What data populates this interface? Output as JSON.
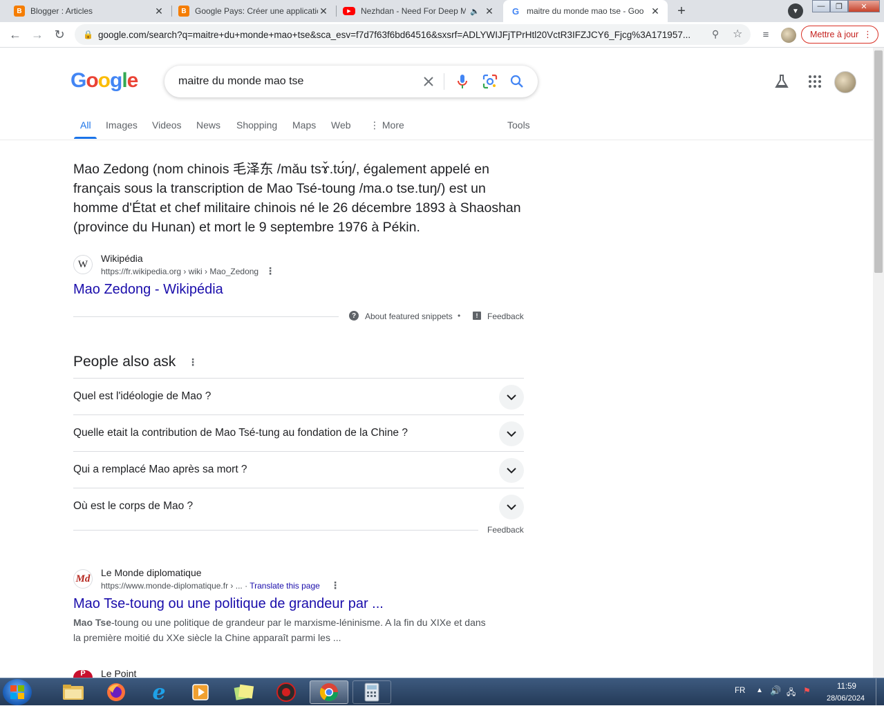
{
  "browser": {
    "tabs": [
      {
        "title": "Blogger : Articles",
        "icon": "blogger-icon",
        "color": "#f57d00"
      },
      {
        "title": "Google Pays: Créer une applicatic",
        "icon": "blogger-icon",
        "color": "#f57d00"
      },
      {
        "title": "Nezhdan - Need For Deep M",
        "icon": "youtube-icon",
        "color": "#ff0000"
      },
      {
        "title": "maitre du monde mao tse - Goo",
        "icon": "google-icon",
        "color": "#4285f4"
      }
    ],
    "url": "google.com/search?q=maitre+du+monde+mao+tse&sca_esv=f7d7f63f6bd64516&sxsrf=ADLYWIJFjTPrHtl20VctR3IFZJCY6_Fjcg%3A171957...",
    "update_label": "Mettre à jour"
  },
  "google": {
    "logo": {
      "letters": [
        "G",
        "o",
        "o",
        "g",
        "l",
        "e"
      ],
      "colors": [
        "#4285f4",
        "#ea4335",
        "#fbbc05",
        "#4285f4",
        "#34a853",
        "#ea4335"
      ]
    },
    "query": "maitre du monde mao tse",
    "tabs": [
      "All",
      "Images",
      "Videos",
      "News",
      "Shopping",
      "Maps",
      "Web",
      "More"
    ],
    "tools": "Tools"
  },
  "snippet": {
    "text": "Mao Zedong (nom chinois 毛泽东 /mǎu tsɤ̌.tʊ́ŋ/, également appelé en français sous la transcription de Mao Tsé-toung /ma.o tse.tuŋ/) est un homme d'État et chef militaire chinois né le 26 décembre 1893 à Shaoshan (province du Hunan) et mort le 9 septembre 1976 à Pékin.",
    "site": "Wikipédia",
    "site_icon": "W",
    "url": "https://fr.wikipedia.org › wiki › Mao_Zedong",
    "title": "Mao Zedong - Wikipédia",
    "about": "About featured snippets",
    "feedback": "Feedback"
  },
  "paa": {
    "title": "People also ask",
    "questions": [
      "Quel est l'idéologie de Mao ?",
      "Quelle etait la contribution de Mao Tsé-tung au fondation de la Chine ?",
      "Qui a remplacé Mao après sa mort ?",
      "Où est le corps de Mao ?"
    ],
    "feedback": "Feedback"
  },
  "results": [
    {
      "site": "Le Monde diplomatique",
      "site_icon": "Md",
      "url": "https://www.monde-diplomatique.fr › ...",
      "translate": "Translate this page",
      "title": "Mao Tse-toung ou une politique de grandeur par ...",
      "desc_bold": "Mao Tse",
      "desc_rest": "-toung ou une politique de grandeur par le marxisme-léninisme. A la fin du XIXe et dans la première moitié du XXe siècle la Chine apparaît parmi les ..."
    },
    {
      "site": "Le Point",
      "site_icon": "P"
    }
  ],
  "taskbar": {
    "lang": "FR",
    "time": "11:59",
    "date": "28/06/2024"
  }
}
